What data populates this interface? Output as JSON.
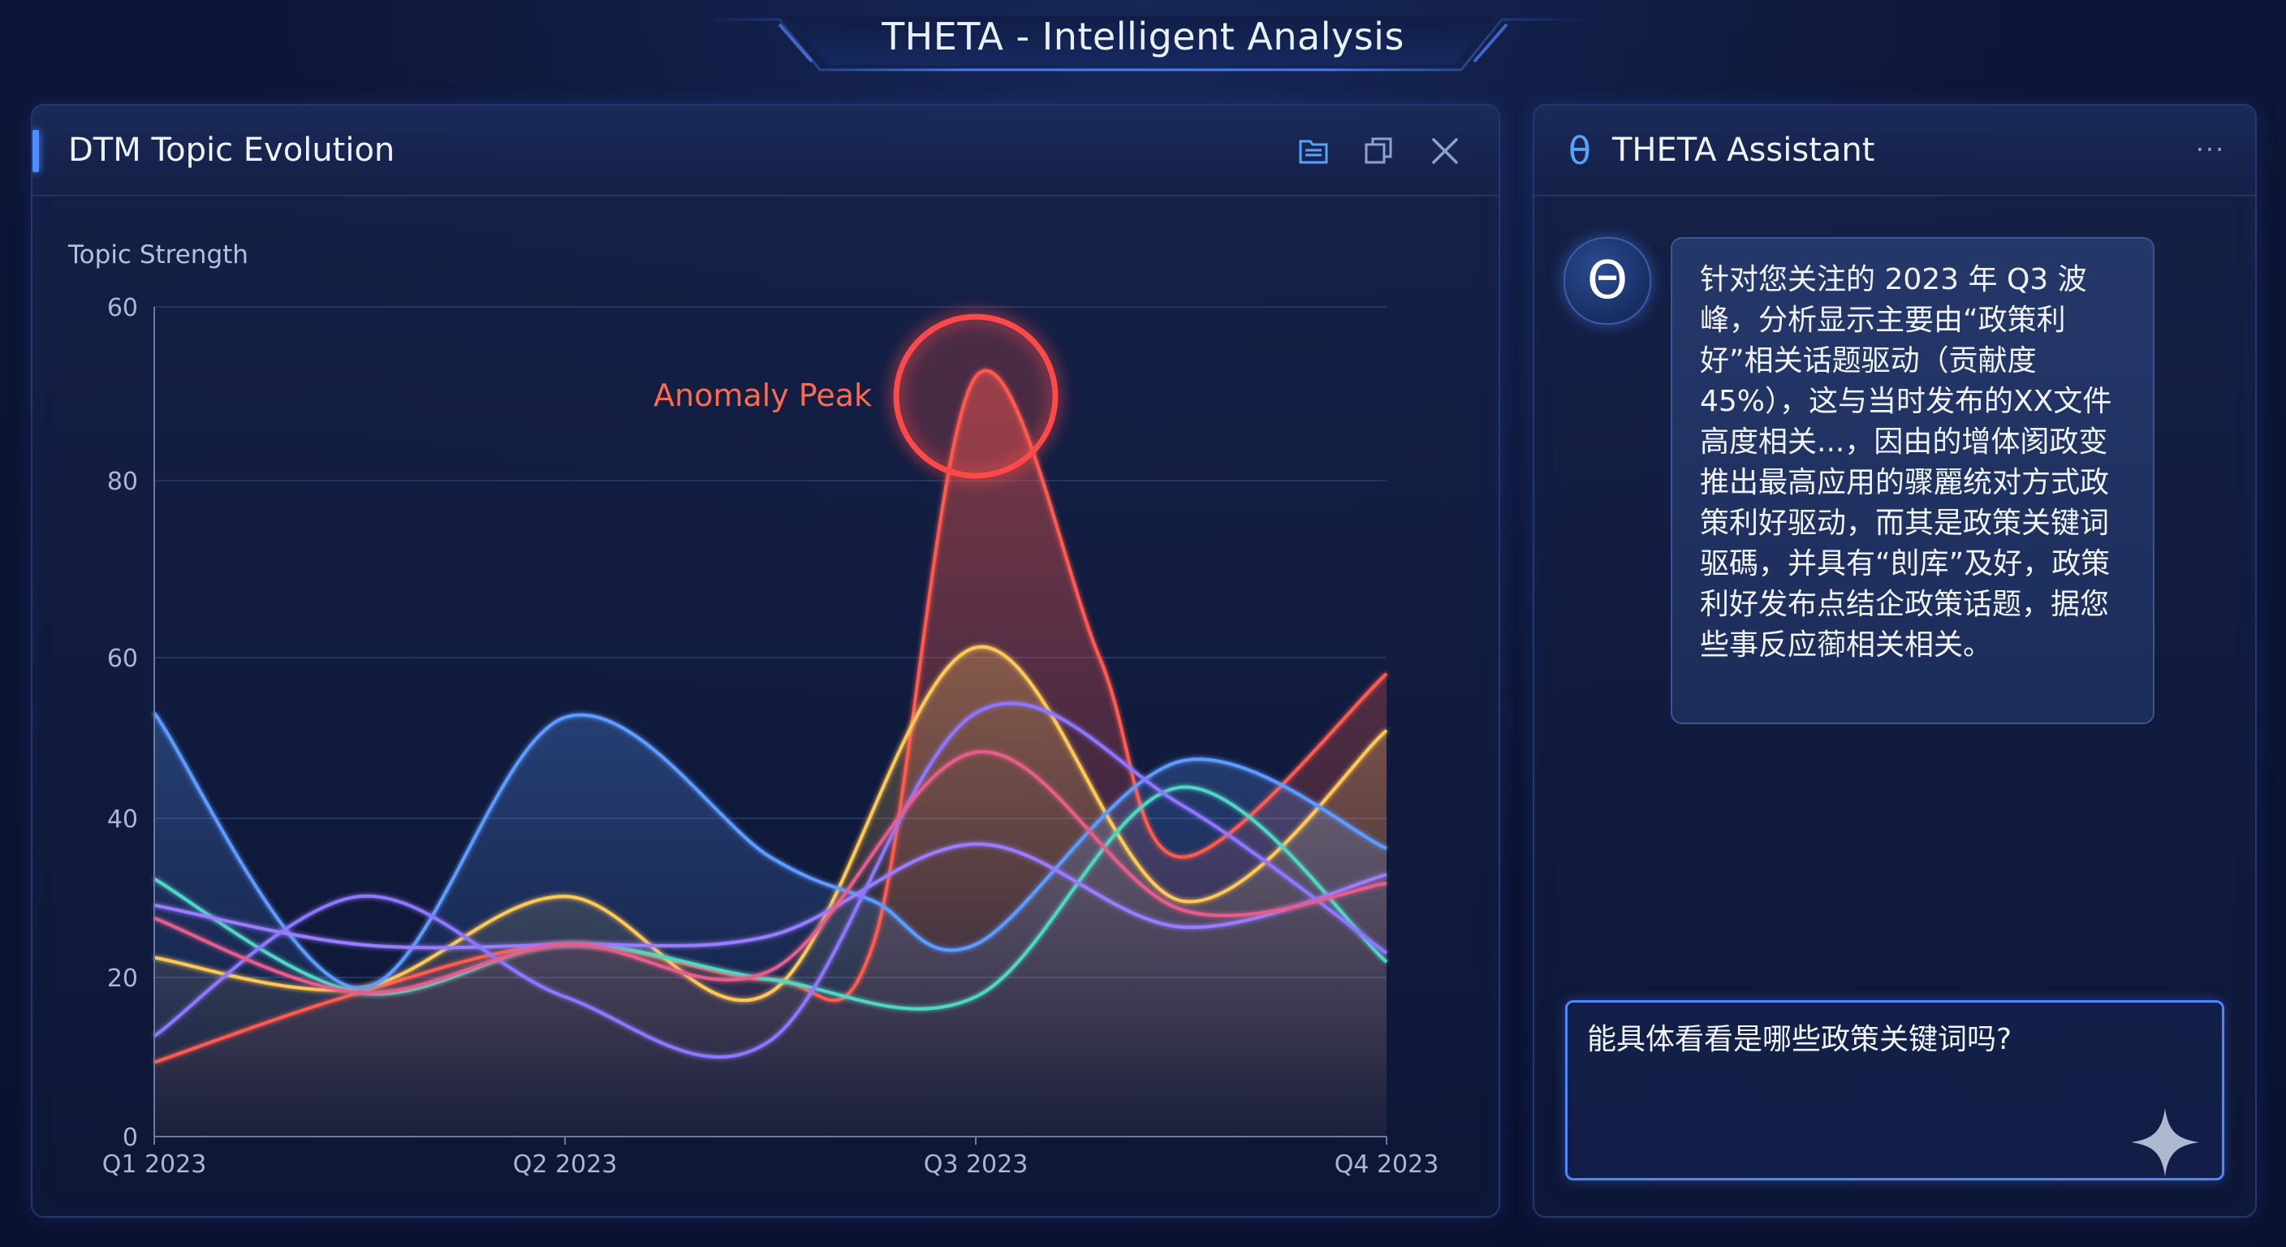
{
  "app": {
    "title": "THETA - Intelligent Analysis"
  },
  "chart_panel": {
    "title": "DTM Topic Evolution",
    "icons": [
      "folder-icon",
      "copy-icon",
      "close-icon"
    ]
  },
  "chart_data": {
    "type": "line",
    "title": "DTM Topic Evolution",
    "ylabel": "Topic Strength",
    "xlabel": "",
    "x_ticks": [
      "Q1 2023",
      "Q2 2023",
      "Q3 2023",
      "Q4 2023"
    ],
    "y_tick_labels": [
      "0",
      "20",
      "40",
      "60",
      "80",
      "60"
    ],
    "annotation": {
      "text": "Anomaly Peak",
      "x": 2.0,
      "series": "red"
    },
    "grid": true,
    "series": [
      {
        "color": "#ff5a4e",
        "x": [
          0,
          0.5,
          1,
          1.5,
          1.75,
          2,
          2.3,
          2.5,
          3
        ],
        "values": [
          8.5,
          16.5,
          22,
          18,
          22,
          87,
          55,
          32,
          53
        ],
        "filled": true
      },
      {
        "color": "#ffc857",
        "x": [
          0,
          0.5,
          1,
          1.5,
          2,
          2.5,
          3
        ],
        "values": [
          20.5,
          17,
          27.5,
          16.5,
          56,
          27,
          46.5
        ],
        "filled": true
      },
      {
        "color": "#5b9bff",
        "x": [
          0,
          0.5,
          1,
          1.5,
          1.75,
          2,
          2.5,
          3
        ],
        "values": [
          48.5,
          17,
          48,
          32,
          27,
          22,
          43,
          33
        ],
        "filled": true
      },
      {
        "color": "#4fd6c4",
        "x": [
          0,
          0.5,
          1,
          1.5,
          2,
          2.5,
          3
        ],
        "values": [
          29.5,
          16.5,
          22,
          18,
          16,
          40,
          20
        ],
        "filled": false
      },
      {
        "color": "#9a7dff",
        "x": [
          0,
          0.5,
          1,
          1.5,
          2,
          2.5,
          3
        ],
        "values": [
          26.5,
          22,
          22,
          23,
          33.5,
          24,
          30
        ],
        "filled": false
      },
      {
        "color": "#8f76ff",
        "x": [
          0,
          0.5,
          1,
          1.5,
          2,
          2.5,
          3
        ],
        "values": [
          11.5,
          27.5,
          16,
          11,
          48.5,
          38,
          21
        ],
        "filled": false
      },
      {
        "color": "#e65d8b",
        "x": [
          0,
          0.5,
          1,
          1.5,
          2,
          2.5,
          3
        ],
        "values": [
          25,
          16.5,
          22,
          19,
          44,
          26,
          29
        ],
        "filled": false
      }
    ]
  },
  "assistant_panel": {
    "logo": "θ",
    "title": "THETA Assistant",
    "more": "···",
    "avatar_glyph": "Θ",
    "bot_message": "针对您关注的 2023 年 Q3 波峰，分析显示主要由“政策利好”相关话题驱动（贡献度 45%），这与当时发布的XX文件高度相关...，因由的增体阂政变推出最高应用的骤麗统对方式政策利好驱动，而其是政策关键词驱碼，并具有“剆库”及好，政策利好发布点结企政策话题，据您些事反应蓹相关相关。",
    "input_value": "能具体看看是哪些政策关键词吗?"
  },
  "colors": {
    "accent": "#4f8cff",
    "anomaly": "#ff5a4e",
    "background": "#0b1330"
  }
}
